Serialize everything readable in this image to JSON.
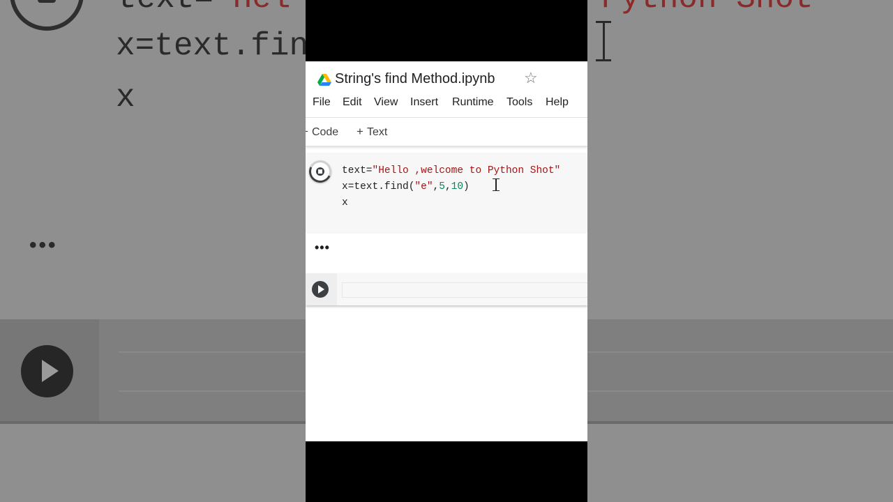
{
  "background_zoom": {
    "code_line1_prefix": "text=",
    "code_line1_string": "\"Hel",
    "code_line1_tail": "Python Shot\"",
    "code_line2": "x=text.fin",
    "code_line3": "x",
    "output_dots": "•••"
  },
  "notebook": {
    "title": "String's find Method.ipynb",
    "menu": [
      "File",
      "Edit",
      "View",
      "Insert",
      "Runtime",
      "Tools",
      "Help"
    ],
    "toolbar": {
      "add_code_label": "Code",
      "add_text_label": "Text"
    },
    "cell1": {
      "line1_prefix": "text=",
      "line1_string": "\"Hello ,welcome to Python Shot\"",
      "line2_prefix": "x=text.find(",
      "line2_string": "\"e\"",
      "line2_comma1": ",",
      "line2_num1": "5",
      "line2_comma2": ",",
      "line2_num2": "10",
      "line2_close": ")",
      "line3": "x"
    },
    "output": {
      "dots": "•••"
    }
  },
  "colors": {
    "code_string": "#a31515",
    "code_number": "#098658",
    "cell_background": "#f7f7f7"
  }
}
